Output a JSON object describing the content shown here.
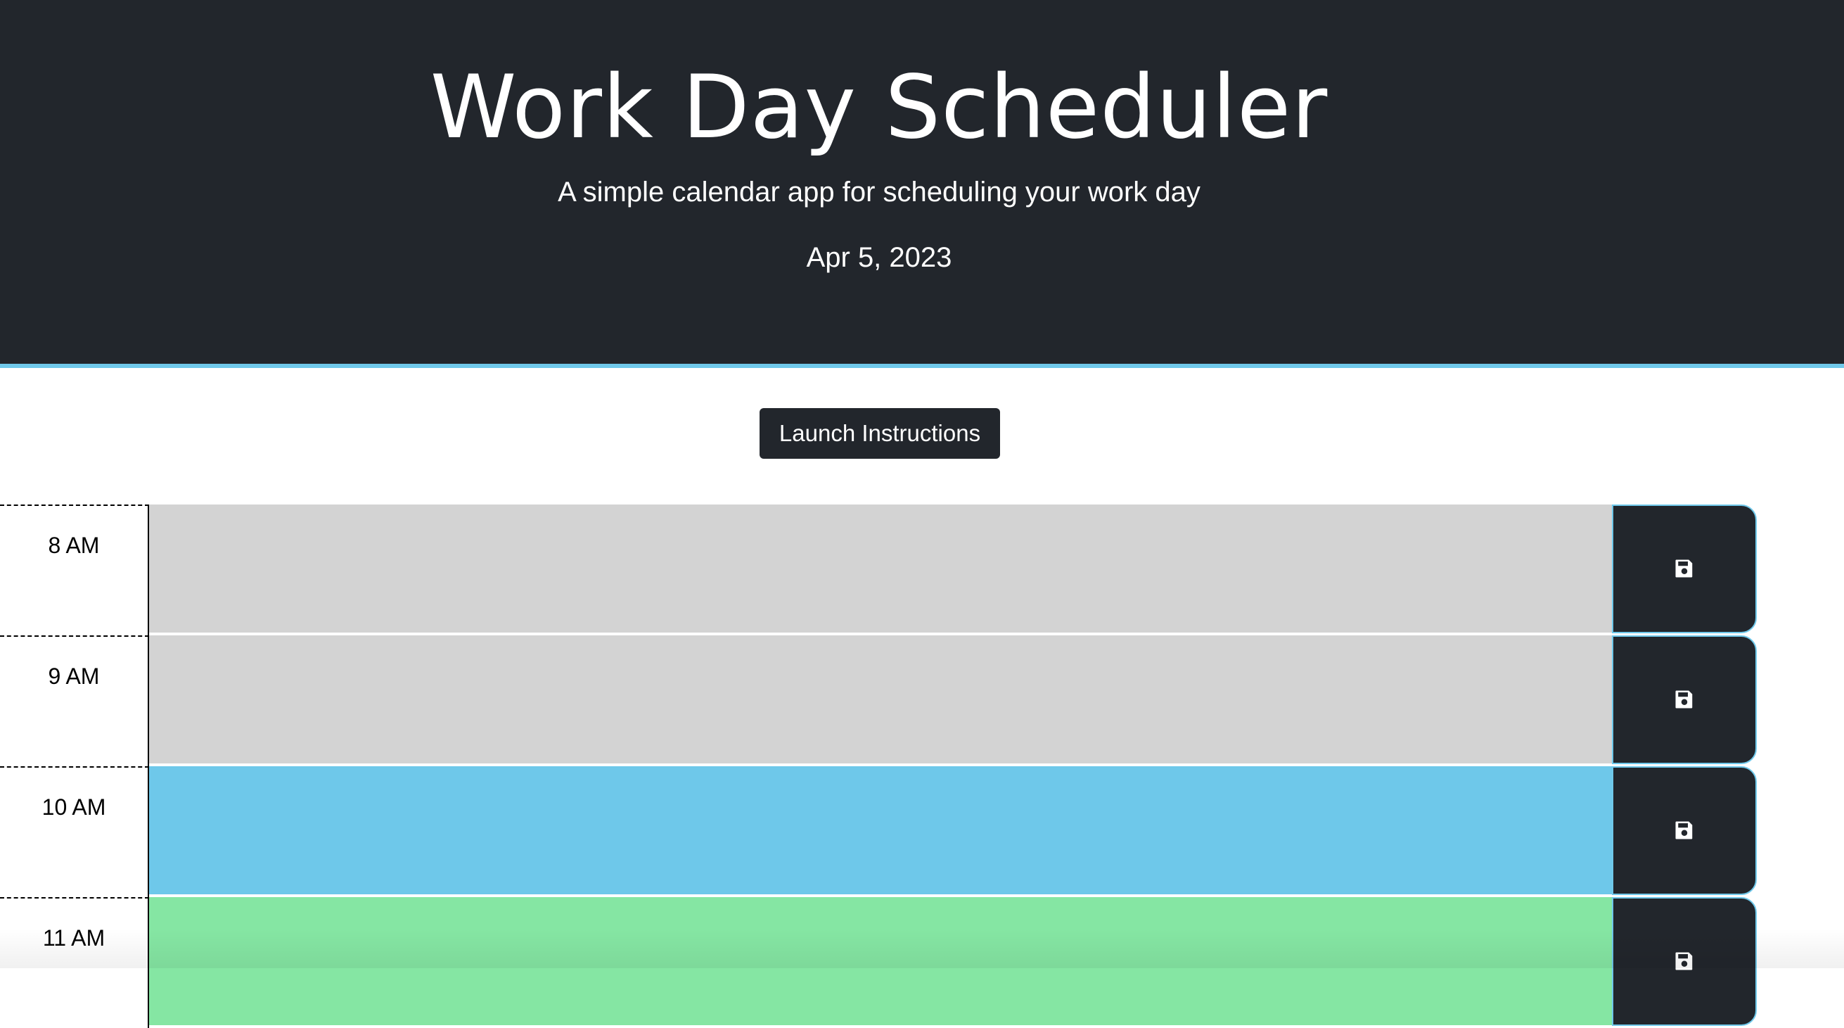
{
  "header": {
    "title": "Work Day Scheduler",
    "subtitle": "A simple calendar app for scheduling your work day",
    "current_date": "Apr 5, 2023"
  },
  "actions": {
    "launch_label": "Launch Instructions"
  },
  "timeblocks": [
    {
      "hour": "8 AM",
      "status": "past",
      "text": "",
      "save_icon": "floppy-disk-icon"
    },
    {
      "hour": "9 AM",
      "status": "past",
      "text": "",
      "save_icon": "floppy-disk-icon"
    },
    {
      "hour": "10 AM",
      "status": "present",
      "text": "",
      "save_icon": "floppy-disk-icon"
    },
    {
      "hour": "11 AM",
      "status": "future",
      "text": "",
      "save_icon": "floppy-disk-icon"
    }
  ],
  "colors": {
    "header_bg": "#22262c",
    "accent": "#6fc8ea",
    "past": "#d3d3d3",
    "present": "#6ec8ea",
    "future": "#85e6a3"
  }
}
